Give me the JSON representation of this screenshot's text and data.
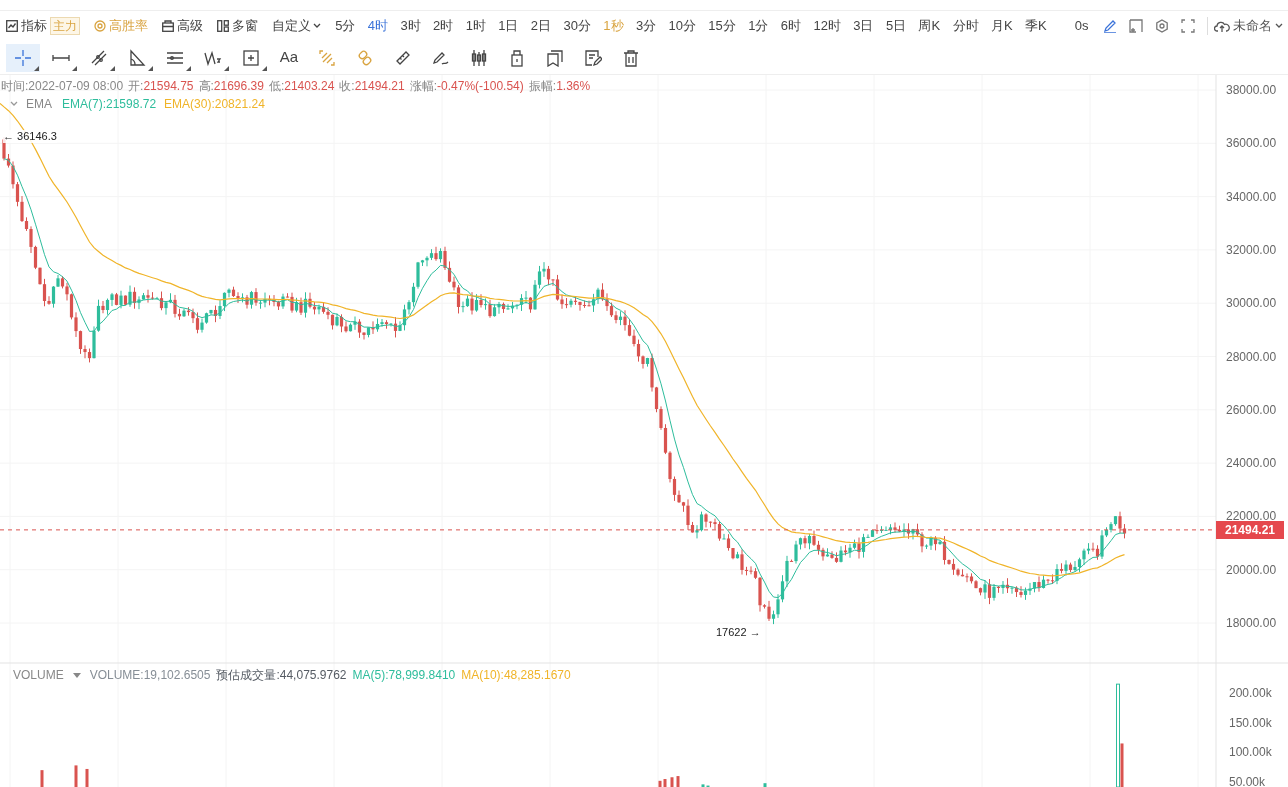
{
  "toolbar": {
    "indicator_button": {
      "label": "指标",
      "badge": "主力"
    },
    "win_rate_button": {
      "label": "高胜率"
    },
    "advanced_button": {
      "label": "高级"
    },
    "multi_window_button": {
      "label": "多窗"
    },
    "custom_dropdown": {
      "label": "自定义"
    },
    "intervals": [
      {
        "label": "5分",
        "selected": false,
        "kind": "plain"
      },
      {
        "label": "4时",
        "selected": true,
        "kind": "plain"
      },
      {
        "label": "3时",
        "selected": false,
        "kind": "plain"
      },
      {
        "label": "2时",
        "selected": false,
        "kind": "plain"
      },
      {
        "label": "1时",
        "selected": false,
        "kind": "plain"
      },
      {
        "label": "1日",
        "selected": false,
        "kind": "plain"
      },
      {
        "label": "2日",
        "selected": false,
        "kind": "plain"
      },
      {
        "label": "30分",
        "selected": false,
        "kind": "plain"
      },
      {
        "label": "1秒",
        "selected": false,
        "kind": "premium"
      },
      {
        "label": "3分",
        "selected": false,
        "kind": "plain"
      },
      {
        "label": "10分",
        "selected": false,
        "kind": "plain"
      },
      {
        "label": "15分",
        "selected": false,
        "kind": "plain"
      },
      {
        "label": "1分",
        "selected": false,
        "kind": "plain"
      },
      {
        "label": "6时",
        "selected": false,
        "kind": "plain"
      },
      {
        "label": "12时",
        "selected": false,
        "kind": "plain"
      },
      {
        "label": "3日",
        "selected": false,
        "kind": "plain"
      },
      {
        "label": "5日",
        "selected": false,
        "kind": "plain"
      },
      {
        "label": "周K",
        "selected": false,
        "kind": "plain"
      },
      {
        "label": "分时",
        "selected": false,
        "kind": "plain"
      },
      {
        "label": "月K",
        "selected": false,
        "kind": "plain"
      },
      {
        "label": "季K",
        "selected": false,
        "kind": "plain"
      }
    ],
    "countdown": "0s",
    "layout_menu": {
      "label": "未命名"
    }
  },
  "drawing_tools": [
    {
      "kind": "crosshair",
      "selected": true,
      "has_menu": true
    },
    {
      "kind": "hline",
      "selected": false,
      "has_menu": true
    },
    {
      "kind": "trend",
      "selected": false,
      "has_menu": true
    },
    {
      "kind": "angle",
      "selected": false,
      "has_menu": true
    },
    {
      "kind": "channel",
      "selected": false,
      "has_menu": true
    },
    {
      "kind": "wave",
      "selected": false,
      "has_menu": true
    },
    {
      "kind": "box",
      "selected": false,
      "has_menu": true
    },
    {
      "kind": "text",
      "selected": false,
      "has_menu": false,
      "label": "Aa"
    },
    {
      "kind": "pattern",
      "selected": false,
      "has_menu": false
    },
    {
      "kind": "link",
      "selected": false,
      "has_menu": false
    },
    {
      "kind": "ruler",
      "selected": false,
      "has_menu": false
    },
    {
      "kind": "brush",
      "selected": false,
      "has_menu": false
    },
    {
      "kind": "candles",
      "selected": false,
      "has_menu": false
    },
    {
      "kind": "lock",
      "selected": false,
      "has_menu": false
    },
    {
      "kind": "copy",
      "selected": false,
      "has_menu": false
    },
    {
      "kind": "note",
      "selected": false,
      "has_menu": false
    },
    {
      "kind": "trash",
      "selected": false,
      "has_menu": false
    }
  ],
  "ohlc": [
    {
      "label": "时间:",
      "value": "2022-07-09 08:00"
    },
    {
      "label": "开:",
      "value": "21594.75"
    },
    {
      "label": "高:",
      "value": "21696.39"
    },
    {
      "label": "低:",
      "value": "21403.24"
    },
    {
      "label": "收:",
      "value": "21494.21"
    },
    {
      "label": "涨幅:",
      "value": "-0.47%(-100.54)"
    },
    {
      "label": "振幅:",
      "value": "1.36%"
    }
  ],
  "main_legend": {
    "name": "EMA",
    "items": [
      {
        "text": "EMA(7):21598.72",
        "color": "#2ebd9c"
      },
      {
        "text": "EMA(30):20821.24",
        "color": "#f0b429"
      }
    ]
  },
  "price_axis": [
    "38000.00",
    "36000.00",
    "34000.00",
    "32000.00",
    "30000.00",
    "28000.00",
    "26000.00",
    "24000.00",
    "22000.00",
    "20000.00",
    "18000.00"
  ],
  "last_price": "21494.21",
  "high_marker": "← 36146.3",
  "low_marker": "17622 →",
  "volume_legend": {
    "name": "VOLUME",
    "items": [
      {
        "text": "VOLUME:19,102.6505",
        "color": "#868e96"
      },
      {
        "text": "预估成交量:44,075.9762",
        "color": "#555b63"
      },
      {
        "text": "MA(5):78,999.8410",
        "color": "#2ebd9c"
      },
      {
        "text": "MA(10):48,285.1670",
        "color": "#f0b429"
      }
    ]
  },
  "volume_axis": [
    "200.00k",
    "150.00k",
    "100.00k",
    "50.00k"
  ]
}
